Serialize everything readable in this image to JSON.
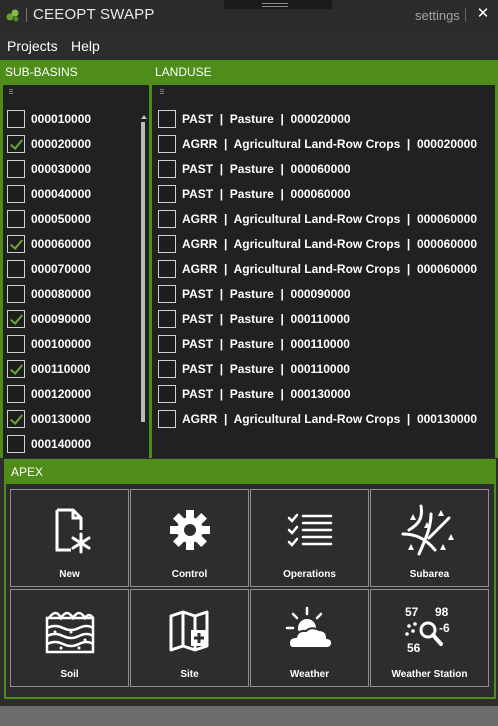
{
  "window": {
    "title": "CEEOPT SWAPP",
    "settings_label": "settings",
    "close_glyph": "✕"
  },
  "menu": {
    "items": [
      {
        "label": "Projects"
      },
      {
        "label": "Help"
      }
    ]
  },
  "sub_basins": {
    "header": "SUB-BASINS",
    "items": [
      {
        "label": "000010000",
        "checked": false
      },
      {
        "label": "000020000",
        "checked": true
      },
      {
        "label": "000030000",
        "checked": false
      },
      {
        "label": "000040000",
        "checked": false
      },
      {
        "label": "000050000",
        "checked": false
      },
      {
        "label": "000060000",
        "checked": true
      },
      {
        "label": "000070000",
        "checked": false
      },
      {
        "label": "000080000",
        "checked": false
      },
      {
        "label": "000090000",
        "checked": true
      },
      {
        "label": "000100000",
        "checked": false
      },
      {
        "label": "000110000",
        "checked": true
      },
      {
        "label": "000120000",
        "checked": false
      },
      {
        "label": "000130000",
        "checked": true
      },
      {
        "label": "000140000",
        "checked": false
      }
    ]
  },
  "landuse": {
    "header": "LANDUSE",
    "items": [
      {
        "label": "PAST  |  Pasture  |  000020000",
        "checked": false
      },
      {
        "label": "AGRR  |  Agricultural Land-Row Crops  |  000020000",
        "checked": false
      },
      {
        "label": "PAST  |  Pasture  |  000060000",
        "checked": false
      },
      {
        "label": "PAST  |  Pasture  |  000060000",
        "checked": false
      },
      {
        "label": "AGRR  |  Agricultural Land-Row Crops  |  000060000",
        "checked": false
      },
      {
        "label": "AGRR  |  Agricultural Land-Row Crops  |  000060000",
        "checked": false
      },
      {
        "label": "AGRR  |  Agricultural Land-Row Crops  |  000060000",
        "checked": false
      },
      {
        "label": "PAST  |  Pasture  |  000090000",
        "checked": false
      },
      {
        "label": "PAST  |  Pasture  |  000110000",
        "checked": false
      },
      {
        "label": "PAST  |  Pasture  |  000110000",
        "checked": false
      },
      {
        "label": "PAST  |  Pasture  |  000110000",
        "checked": false
      },
      {
        "label": "PAST  |  Pasture  |  000130000",
        "checked": false
      },
      {
        "label": "AGRR  |  Agricultural Land-Row Crops  |  000130000",
        "checked": false
      }
    ]
  },
  "apex": {
    "header": "APEX",
    "tiles": [
      {
        "label": "New",
        "icon": "new-document-icon"
      },
      {
        "label": "Control",
        "icon": "gear-icon"
      },
      {
        "label": "Operations",
        "icon": "checklist-icon"
      },
      {
        "label": "Subarea",
        "icon": "watershed-icon"
      },
      {
        "label": "Soil",
        "icon": "soil-layers-icon"
      },
      {
        "label": "Site",
        "icon": "map-icon"
      },
      {
        "label": "Weather",
        "icon": "sun-cloud-icon"
      },
      {
        "label": "Weather Station",
        "icon": "weather-station-search-icon"
      }
    ],
    "station_icon_digits": [
      "57",
      "98",
      "-6",
      "56"
    ]
  },
  "colors": {
    "accent_green": "#4e8d1a",
    "check_green": "#6ea33a",
    "panel_bg": "#212121",
    "window_bg": "#2d2d2d"
  }
}
